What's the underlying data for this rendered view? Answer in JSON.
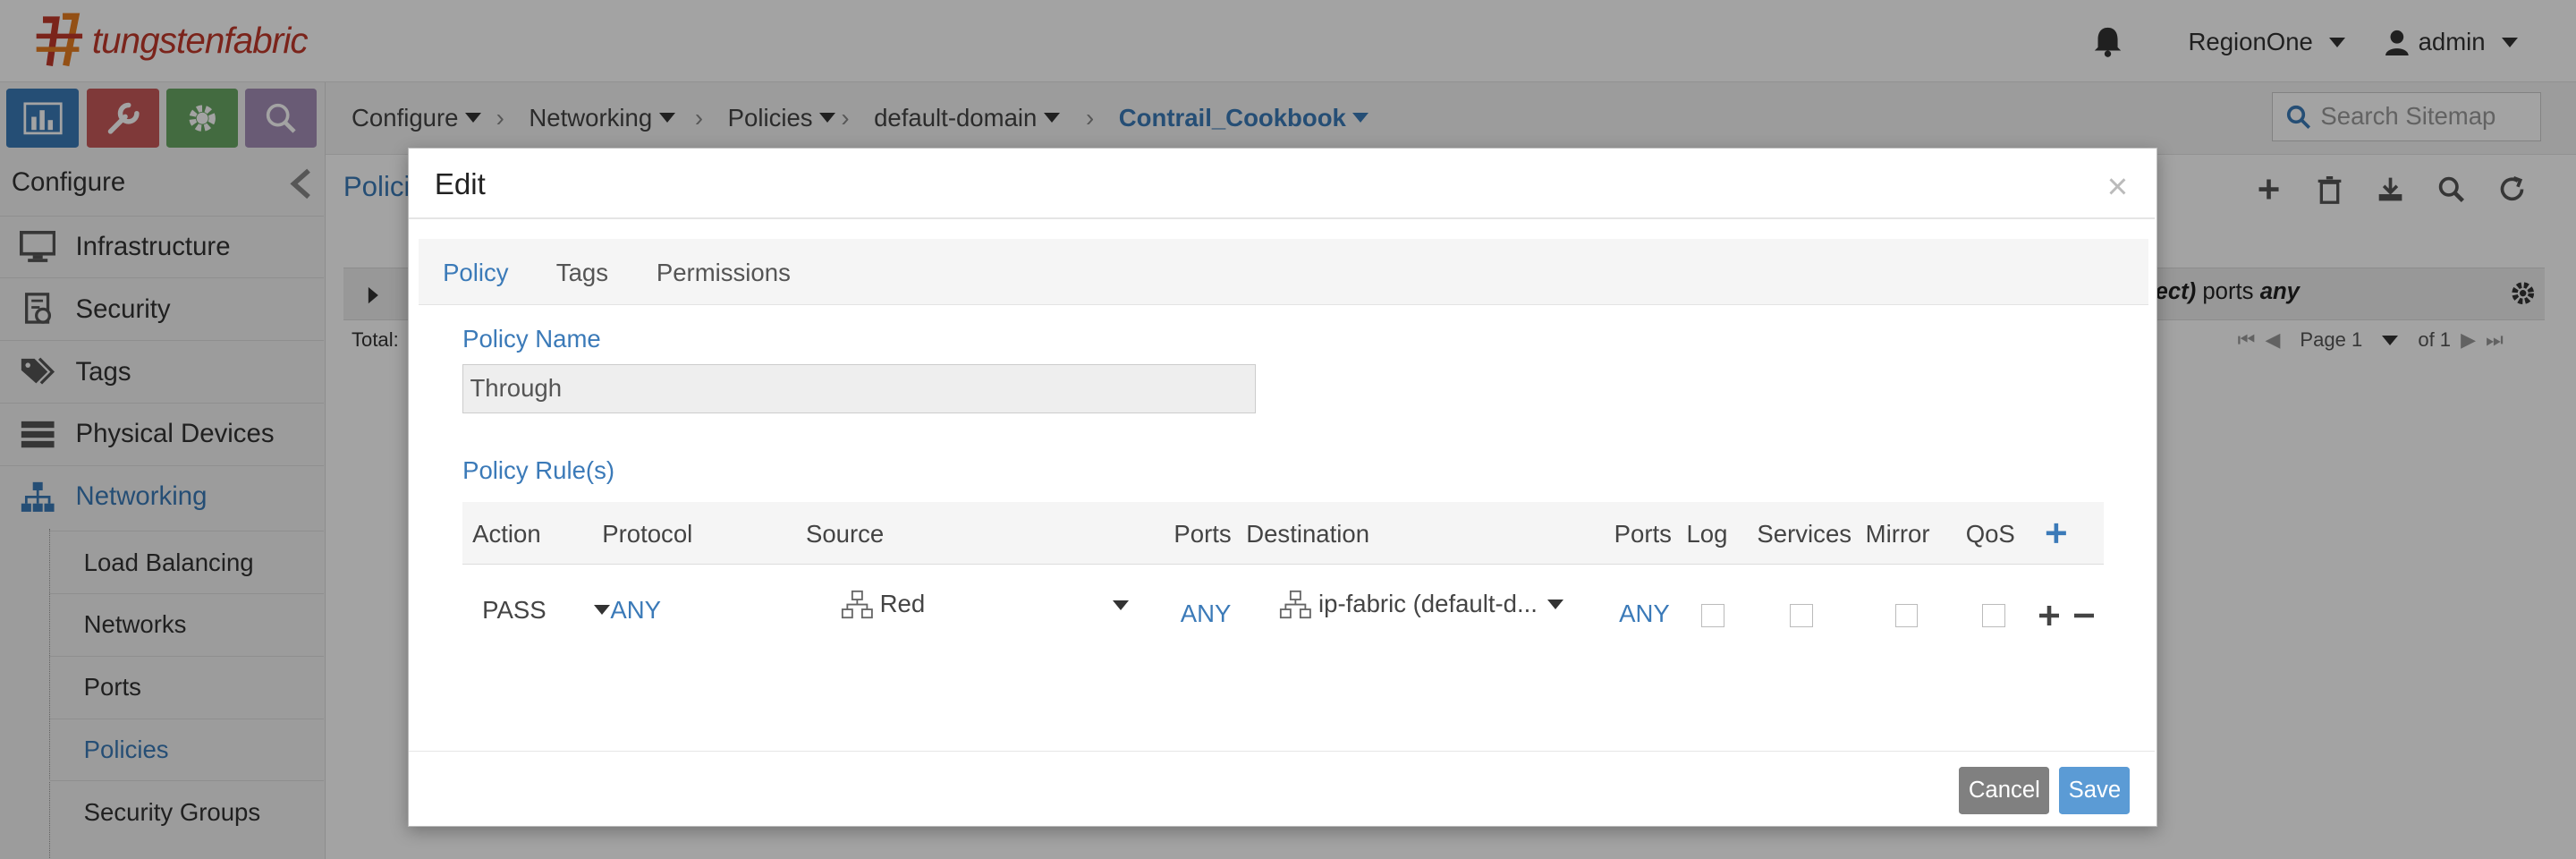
{
  "header": {
    "brand": "tungstenfabric",
    "region": "RegionOne",
    "user": "admin"
  },
  "sidebar": {
    "title": "Configure",
    "items": [
      {
        "label": "Infrastructure",
        "icon": "monitor-icon"
      },
      {
        "label": "Security",
        "icon": "security-icon"
      },
      {
        "label": "Tags",
        "icon": "tags-icon"
      },
      {
        "label": "Physical Devices",
        "icon": "server-icon"
      },
      {
        "label": "Networking",
        "icon": "network-icon"
      }
    ],
    "subitems": [
      "Load Balancing",
      "Networks",
      "Ports",
      "Policies",
      "Security Groups"
    ]
  },
  "breadcrumb": [
    "Configure",
    "Networking",
    "Policies",
    "default-domain",
    "Contrail_Cookbook"
  ],
  "search": {
    "placeholder": "Search Sitemap"
  },
  "background": {
    "title": "Polici",
    "total": "Total:",
    "rule_fragment": "ject) ports any",
    "rule_fragment_a": "ject)",
    "rule_fragment_b": " ports ",
    "rule_fragment_c": "any",
    "page": "Page 1",
    "of": "of 1"
  },
  "modal": {
    "title": "Edit",
    "tabs": [
      "Policy",
      "Tags",
      "Permissions"
    ],
    "policy_name_label": "Policy Name",
    "policy_name_value": "Through",
    "rules_label": "Policy Rule(s)",
    "columns": [
      "Action",
      "Protocol",
      "Source",
      "Ports",
      "Destination",
      "Ports",
      "Log",
      "Services",
      "Mirror",
      "QoS"
    ],
    "rule": {
      "action": "PASS",
      "protocol": "ANY",
      "source": "Red",
      "source_ports": "ANY",
      "destination": "ip-fabric (default-d...",
      "destination_ports": "ANY",
      "log": false,
      "services": false,
      "mirror": false,
      "qos": false
    },
    "cancel": "Cancel",
    "save": "Save"
  },
  "colors": {
    "accent": "#3b7ab8",
    "save": "#5b9bd5",
    "cancel": "#808080"
  }
}
